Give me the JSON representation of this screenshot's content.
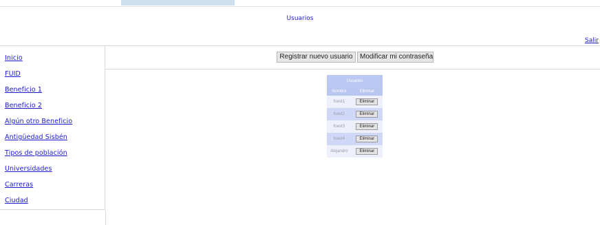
{
  "header": {
    "title": "Usuarios",
    "logout_label": "Salir"
  },
  "sidebar": {
    "items": [
      {
        "label": "Inicio"
      },
      {
        "label": "FUID"
      },
      {
        "label": "Beneficio 1"
      },
      {
        "label": "Beneficio 2"
      },
      {
        "label": "Algún otro Beneficio"
      },
      {
        "label": "Antigüedad Sisbén"
      },
      {
        "label": "Tipos de población"
      },
      {
        "label": "Universidades"
      },
      {
        "label": "Carreras"
      },
      {
        "label": "Ciudad"
      }
    ]
  },
  "toolbar": {
    "register_label": "Registrar nuevo usuario",
    "change_password_label": "Modificar mi contraseña"
  },
  "users_table": {
    "caption": "Usuarios",
    "columns": [
      "Nombre",
      "Eliminar"
    ],
    "rows": [
      {
        "name": "foest1",
        "action": "Eliminar"
      },
      {
        "name": "foest2",
        "action": "Eliminar"
      },
      {
        "name": "foest3",
        "action": "Eliminar"
      },
      {
        "name": "foest4",
        "action": "Eliminar"
      },
      {
        "name": "Alejandro",
        "action": "Eliminar"
      }
    ]
  },
  "colors": {
    "link": "#1a1acc",
    "table_header": "#b8c6f0",
    "row_light": "#eef1fb",
    "row_dark": "#cfd8f6",
    "top_strip": "#cfe0ec"
  }
}
